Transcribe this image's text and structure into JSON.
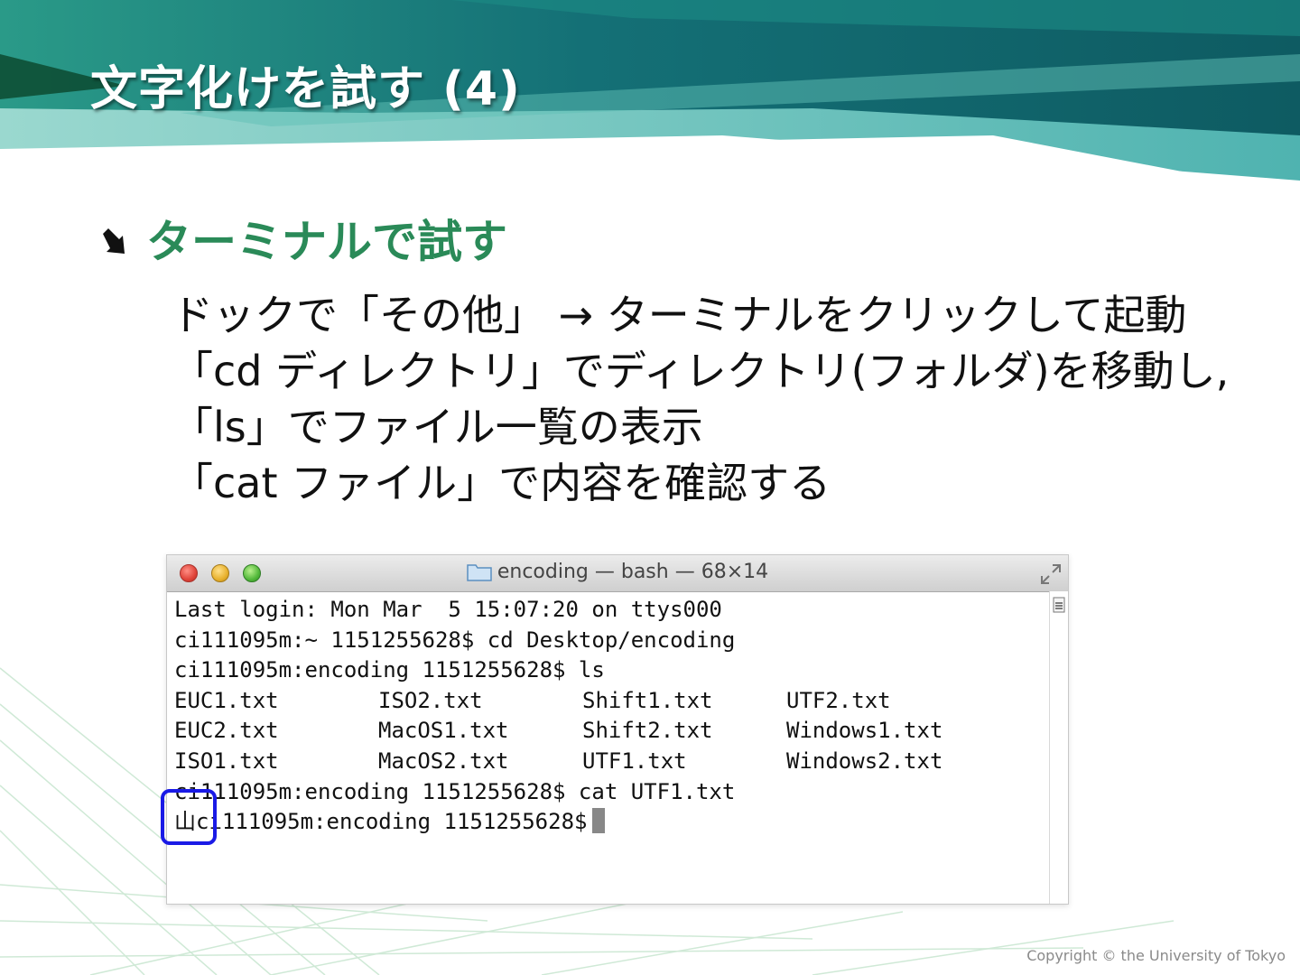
{
  "slide": {
    "title": "文字化けを試す (4)",
    "heading": "ターミナルで試す",
    "body_lines": [
      "ドックで「その他」 → ターミナルをクリックして起動",
      "「cd ディレクトリ」でディレクトリ(フォルダ)を移動し,",
      "「ls」でファイル一覧の表示",
      "「cat ファイル」で内容を確認する"
    ],
    "copyright": "Copyright © the University of Tokyo"
  },
  "terminal": {
    "window_title": "encoding — bash — 68×14",
    "lines": [
      "Last login: Mon Mar  5 15:07:20 on ttys000",
      "ci111095m:~ 1151255628$ cd Desktop/encoding",
      "ci111095m:encoding 1151255628$ ls"
    ],
    "ls_grid": [
      [
        "EUC1.txt",
        "ISO2.txt",
        "Shift1.txt",
        "UTF2.txt"
      ],
      [
        "EUC2.txt",
        "MacOS1.txt",
        "Shift2.txt",
        "Windows1.txt"
      ],
      [
        "ISO1.txt",
        "MacOS2.txt",
        "UTF1.txt",
        "Windows2.txt"
      ]
    ],
    "cat_line": "ci111095m:encoding 1151255628$ cat UTF1.txt",
    "last_line": "山ci111095m:encoding 1151255628$"
  },
  "colors": {
    "heading": "#2a8a58",
    "banner_dark": "#0f5a5e",
    "banner_light": "#8fd3cf",
    "highlight": "#1a1ae6"
  }
}
